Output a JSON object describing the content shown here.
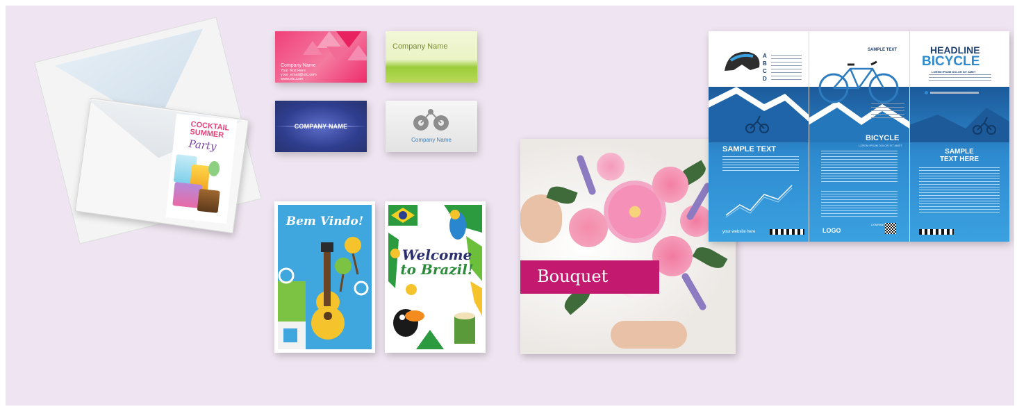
{
  "canvas": {
    "background": "#efe4f1"
  },
  "envelope": {
    "card_line1": "COCKTAIL",
    "card_line2": "SUMMER",
    "card_script": "Party"
  },
  "business_cards": [
    {
      "id": "pink",
      "name": "Company Name",
      "line2": "Your Text Here",
      "line3": "your_email@etc.com",
      "line4": "www.etc.com",
      "color": "#f0417a"
    },
    {
      "id": "green",
      "name": "Company Name",
      "color": "#9bcc3a"
    },
    {
      "id": "navy",
      "name": "COMPANY NAME",
      "color": "#2f3d8e"
    },
    {
      "id": "gray",
      "name": "Company Name",
      "color": "#3f7fb9"
    }
  ],
  "postcards": [
    {
      "id": "bem-vindo",
      "title": "Bem Vindo!",
      "color": "#3fa7dd"
    },
    {
      "id": "welcome-brazil",
      "title_line1": "Welcome",
      "title_line2": "to Brazil!",
      "color": "#2a2e6f"
    }
  ],
  "bouquet": {
    "label": "Bouquet",
    "band_color": "#c31a6f"
  },
  "brochure": {
    "abcd": [
      "A",
      "B",
      "C",
      "D"
    ],
    "panel2_top": "SAMPLE TEXT",
    "headline1": "HEADLINE",
    "headline2": "BICYCLE",
    "headline_sub": "LOREM IPSUM DOLOR SIT AMET",
    "sample_text_left": "SAMPLE TEXT",
    "mid_title": "BICYCLE",
    "mid_sub": "LOREM IPSUM DOLOR SIT AMET",
    "quote_line1": "SAMPLE",
    "quote_line2": "TEXT HERE",
    "website": "your website here",
    "logo": "LOGO",
    "company": "COMPANY",
    "accent": "#2e8bd0"
  }
}
